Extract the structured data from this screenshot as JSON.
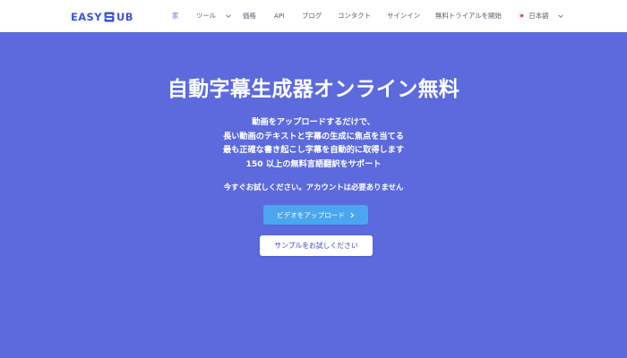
{
  "header": {
    "logo": {
      "left_text": "EASY",
      "right_text": "UB",
      "mark_icon": "s-swirl-logo-icon"
    },
    "nav": [
      {
        "id": "home",
        "label": "家",
        "active": true
      },
      {
        "id": "tools",
        "label": "ツール",
        "has_dropdown": true
      },
      {
        "id": "pricing",
        "label": "価格"
      },
      {
        "id": "api",
        "label": "API"
      },
      {
        "id": "blog",
        "label": "ブログ"
      },
      {
        "id": "contact",
        "label": "コンタクト"
      },
      {
        "id": "signin",
        "label": "サインイン"
      },
      {
        "id": "free_trial",
        "label": "無料トライアルを開始"
      },
      {
        "id": "language",
        "label": "日本語",
        "has_dropdown": true,
        "flag": "japan-flag-icon"
      }
    ]
  },
  "hero": {
    "title": "自動字幕生成器オンライン無料",
    "description_lines": [
      "動画をアップロードするだけで、",
      "長い動画のテキストと字幕の生成に焦点を当てる",
      "最も正確な書き起こし字幕を自動的に取得します",
      "150 以上の無料言語翻訳をサポート"
    ],
    "trial_text": "今すぐお試しください。アカウントは必要ありません",
    "upload_button": "ビデオをアップロード",
    "sample_button": "サンプルをお試しください"
  },
  "colors": {
    "hero_background": "#5c6ade",
    "brand_blue": "#3f55d6",
    "upload_button": "#4aa6ee",
    "nav_active": "#5a74e6"
  }
}
